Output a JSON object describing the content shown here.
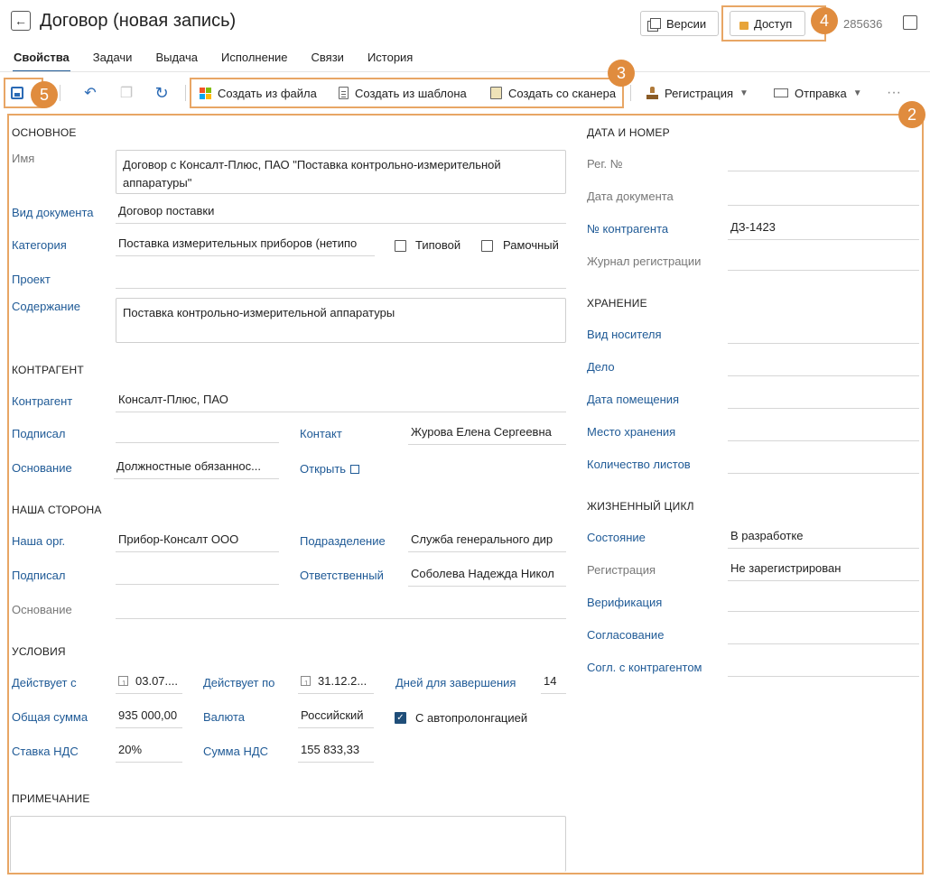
{
  "header": {
    "title": "Договор (новая запись)",
    "versions_label": "Версии",
    "access_label": "Доступ",
    "doc_id": "285636"
  },
  "tabs": [
    {
      "label": "Свойства",
      "active": true
    },
    {
      "label": "Задачи"
    },
    {
      "label": "Выдача"
    },
    {
      "label": "Исполнение"
    },
    {
      "label": "Связи"
    },
    {
      "label": "История"
    }
  ],
  "toolbar": {
    "create_from_file": "Создать из файла",
    "create_from_template": "Создать из шаблона",
    "create_from_scanner": "Создать со сканера",
    "registration": "Регистрация",
    "sending": "Отправка"
  },
  "annotations": {
    "a2": "2",
    "a3": "3",
    "a4": "4",
    "a5": "5"
  },
  "basic": {
    "section": "ОСНОВНОЕ",
    "name_label": "Имя",
    "name_value": "Договор с Консалт-Плюс, ПАО \"Поставка контрольно-измерительной аппаратуры\"",
    "doc_kind_label": "Вид документа",
    "doc_kind_value": "Договор поставки",
    "category_label": "Категория",
    "category_value": "Поставка измерительных приборов (нетипо",
    "typical_label": "Типовой",
    "frame_label": "Рамочный",
    "project_label": "Проект",
    "content_label": "Содержание",
    "content_value": "Поставка контрольно-измерительной аппаратуры"
  },
  "counterparty": {
    "section": "КОНТРАГЕНТ",
    "cp_label": "Контрагент",
    "cp_value": "Консалт-Плюс, ПАО",
    "signed_label": "Подписал",
    "contact_label": "Контакт",
    "contact_value": "Журова Елена Сергеевна",
    "basis_label": "Основание",
    "basis_value": "Должностные обязаннос...",
    "open_link": "Открыть"
  },
  "our_side": {
    "section": "НАША СТОРОНА",
    "org_label": "Наша орг.",
    "org_value": "Прибор-Консалт ООО",
    "dept_label": "Подразделение",
    "dept_value": "Служба генерального дир",
    "signed_label": "Подписал",
    "resp_label": "Ответственный",
    "resp_value": "Соболева Надежда Никол",
    "basis_label": "Основание"
  },
  "terms": {
    "section": "УСЛОВИЯ",
    "from_label": "Действует с",
    "from_value": "03.07....",
    "to_label": "Действует по",
    "to_value": "31.12.2...",
    "days_label": "Дней для завершения",
    "days_value": "14",
    "total_label": "Общая сумма",
    "total_value": "935 000,00",
    "currency_label": "Валюта",
    "currency_value": "Российский",
    "autoprolong_label": "С автопролонгацией",
    "vat_rate_label": "Ставка НДС",
    "vat_rate_value": "20%",
    "vat_sum_label": "Сумма НДС",
    "vat_sum_value": "155 833,33"
  },
  "note": {
    "section": "ПРИМЕЧАНИЕ"
  },
  "date_number": {
    "section": "ДАТА И НОМЕР",
    "reg_no_label": "Рег. №",
    "doc_date_label": "Дата документа",
    "cp_no_label": "№ контрагента",
    "cp_no_value": "ДЗ-1423",
    "journal_label": "Журнал регистрации"
  },
  "storage": {
    "section": "ХРАНЕНИЕ",
    "medium_label": "Вид носителя",
    "case_label": "Дело",
    "placed_label": "Дата помещения",
    "place_label": "Место хранения",
    "sheets_label": "Количество листов"
  },
  "lifecycle": {
    "section": "ЖИЗНЕННЫЙ ЦИКЛ",
    "state_label": "Состояние",
    "state_value": "В разработке",
    "registration_label": "Регистрация",
    "registration_value": "Не зарегистрирован",
    "verification_label": "Верификация",
    "approval_label": "Согласование",
    "cp_approval_label": "Согл. с контрагентом"
  }
}
